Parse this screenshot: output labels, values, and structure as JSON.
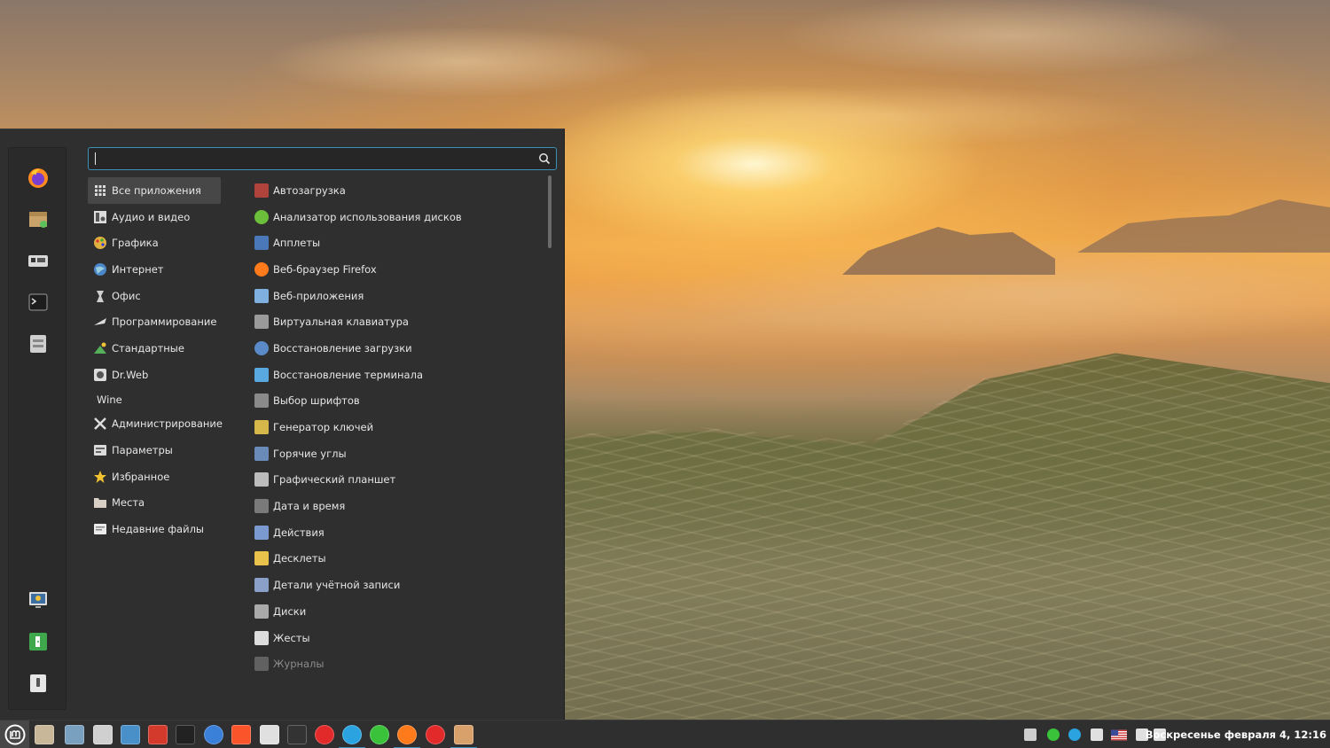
{
  "search": {
    "value": "",
    "placeholder": ""
  },
  "favorites": [
    {
      "name": "firefox-icon"
    },
    {
      "name": "package-manager-icon"
    },
    {
      "name": "driver-manager-icon"
    },
    {
      "name": "terminal-icon"
    },
    {
      "name": "file-manager-icon"
    }
  ],
  "session_buttons": [
    {
      "name": "lock-screen-icon"
    },
    {
      "name": "logout-icon"
    },
    {
      "name": "shutdown-icon"
    }
  ],
  "categories": [
    {
      "label": "Все приложения",
      "icon": "grid-icon",
      "active": true
    },
    {
      "label": "Аудио и видео",
      "icon": "multimedia-icon"
    },
    {
      "label": "Графика",
      "icon": "graphics-icon"
    },
    {
      "label": "Интернет",
      "icon": "internet-icon"
    },
    {
      "label": "Офис",
      "icon": "office-icon"
    },
    {
      "label": "Программирование",
      "icon": "programming-icon"
    },
    {
      "label": "Стандартные",
      "icon": "accessories-icon"
    },
    {
      "label": "Dr.Web",
      "icon": "drweb-icon"
    },
    {
      "label": "Wine",
      "icon": ""
    },
    {
      "label": "Администрирование",
      "icon": "administration-icon"
    },
    {
      "label": "Параметры",
      "icon": "preferences-icon"
    },
    {
      "label": "Избранное",
      "icon": "star-icon"
    },
    {
      "label": "Места",
      "icon": "folder-icon"
    },
    {
      "label": "Недавние файлы",
      "icon": "recent-files-icon"
    }
  ],
  "apps": [
    {
      "label": "Автозагрузка",
      "icon": "startup-icon",
      "color": "#b0443c"
    },
    {
      "label": "Анализатор использования дисков",
      "icon": "disk-usage-icon",
      "color": "#6bbf3a"
    },
    {
      "label": "Апплеты",
      "icon": "applets-icon",
      "color": "#4a78b8"
    },
    {
      "label": "Веб-браузер Firefox",
      "icon": "firefox-icon",
      "color": "#ff7a1a"
    },
    {
      "label": "Веб-приложения",
      "icon": "webapps-icon",
      "color": "#7fb0e0"
    },
    {
      "label": "Виртуальная клавиатура",
      "icon": "keyboard-icon",
      "color": "#9a9a9a"
    },
    {
      "label": "Восстановление загрузки",
      "icon": "boot-repair-icon",
      "color": "#5a8ac8"
    },
    {
      "label": "Восстановление терминала",
      "icon": "terminal-repair-icon",
      "color": "#5aa8e0"
    },
    {
      "label": "Выбор шрифтов",
      "icon": "fonts-icon",
      "color": "#8a8a8a"
    },
    {
      "label": "Генератор ключей",
      "icon": "keygen-icon",
      "color": "#d6b84a"
    },
    {
      "label": "Горячие углы",
      "icon": "hot-corners-icon",
      "color": "#6a8ab8"
    },
    {
      "label": "Графический планшет",
      "icon": "tablet-icon",
      "color": "#bcbcbc"
    },
    {
      "label": "Дата и время",
      "icon": "datetime-icon",
      "color": "#7a7a7a"
    },
    {
      "label": "Действия",
      "icon": "actions-icon",
      "color": "#7a9ad0"
    },
    {
      "label": "Десклеты",
      "icon": "desklets-icon",
      "color": "#e8c24a"
    },
    {
      "label": "Детали учётной записи",
      "icon": "account-icon",
      "color": "#8aa0c8"
    },
    {
      "label": "Диски",
      "icon": "disks-icon",
      "color": "#aaaaaa"
    },
    {
      "label": "Жесты",
      "icon": "gestures-icon",
      "color": "#dddddd"
    },
    {
      "label": "Журналы",
      "icon": "logs-icon",
      "color": "#8a8a8a",
      "dim": true
    }
  ],
  "taskbar": [
    {
      "name": "file-manager-icon",
      "color": "#c9b79a"
    },
    {
      "name": "calculator-icon",
      "color": "#7aa0c0"
    },
    {
      "name": "archive-icon",
      "color": "#d0d0d0"
    },
    {
      "name": "screenshot-icon",
      "color": "#4a90c8"
    },
    {
      "name": "double-commander-icon",
      "color": "#d43a2c"
    },
    {
      "name": "terminal-icon",
      "color": "#222222"
    },
    {
      "name": "thunderbird-icon",
      "color": "#3a7fd8"
    },
    {
      "name": "brave-icon",
      "color": "#fb542b"
    },
    {
      "name": "text-editor-icon",
      "color": "#e0e0e0"
    },
    {
      "name": "system-monitor-icon",
      "color": "#333333"
    },
    {
      "name": "youtube-music-icon",
      "color": "#e22a2a"
    },
    {
      "name": "telegram-icon",
      "color": "#2aa3e0",
      "active": true
    },
    {
      "name": "icq-icon",
      "color": "#3ac23a"
    },
    {
      "name": "firefox-icon",
      "color": "#ff7a1a",
      "active": true
    },
    {
      "name": "yandex-browser-icon",
      "color": "#e22a2a"
    },
    {
      "name": "eye-app-icon",
      "color": "#d8a06a",
      "active": true
    }
  ],
  "tray": [
    {
      "name": "drweb-tray-icon"
    },
    {
      "name": "icq-tray-icon"
    },
    {
      "name": "telegram-tray-icon"
    },
    {
      "name": "printer-icon"
    },
    {
      "name": "us-flag-icon"
    },
    {
      "name": "network-icon"
    },
    {
      "name": "sound-icon"
    }
  ],
  "clock": {
    "text": "Воскресенье февраля  4, 12:16"
  }
}
